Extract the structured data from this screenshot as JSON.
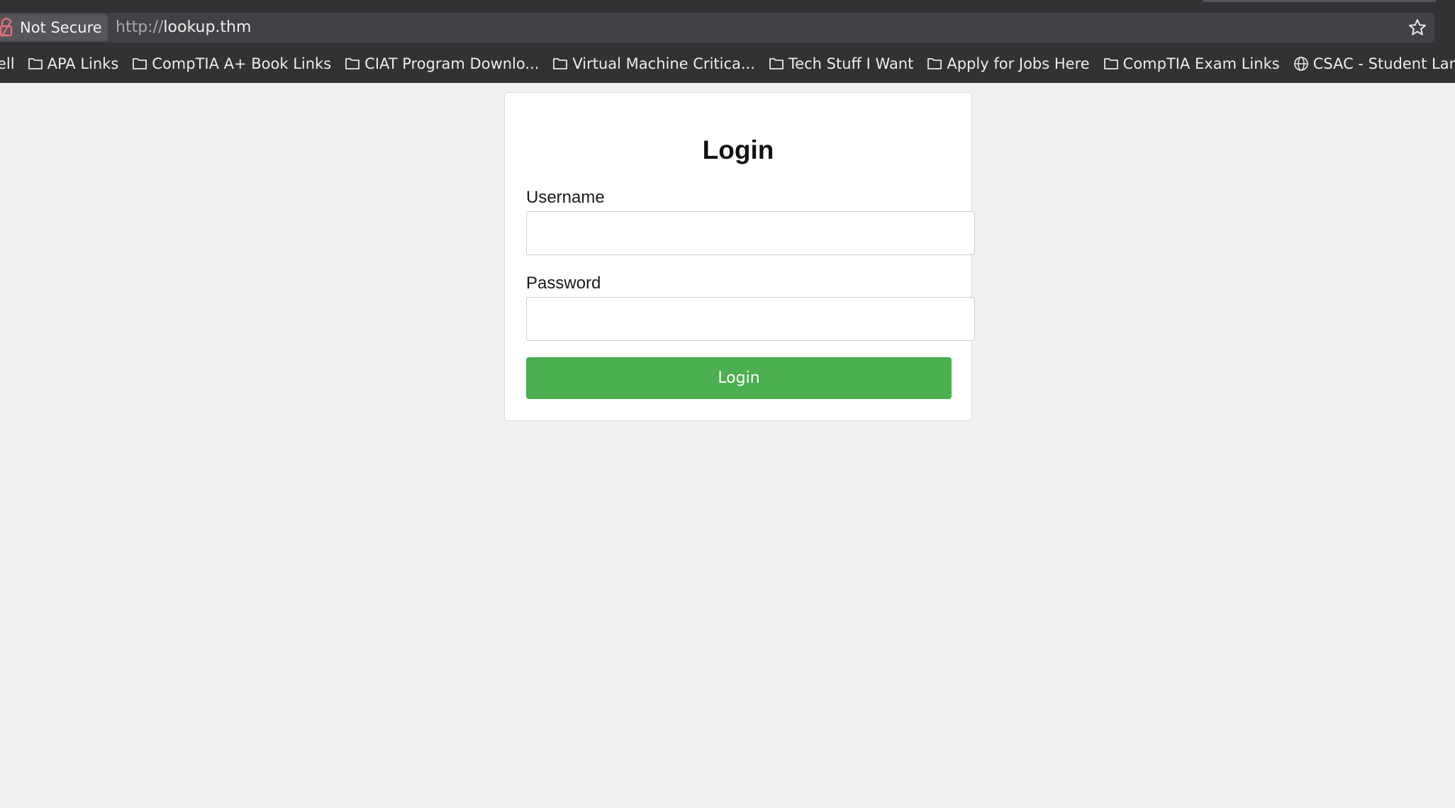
{
  "browser": {
    "security_label": "Not Secure",
    "url_scheme": "http://",
    "url_host": "lookup.thm",
    "icons": {
      "security": "broken-lock-icon",
      "bookmark_star": "star-icon",
      "folder": "folder-icon",
      "globe": "globe-icon"
    },
    "colors": {
      "security_icon": "#e5737b"
    }
  },
  "bookmarks": [
    {
      "label": "ell",
      "icon": "none"
    },
    {
      "label": "APA Links",
      "icon": "folder-icon"
    },
    {
      "label": "CompTIA A+ Book Links",
      "icon": "folder-icon"
    },
    {
      "label": "CIAT Program Downlo...",
      "icon": "folder-icon"
    },
    {
      "label": "Virtual Machine Critica...",
      "icon": "folder-icon"
    },
    {
      "label": "Tech Stuff I Want",
      "icon": "folder-icon"
    },
    {
      "label": "Apply for Jobs Here",
      "icon": "folder-icon"
    },
    {
      "label": "CompTIA Exam Links",
      "icon": "folder-icon"
    },
    {
      "label": "CSAC - Student Landin...",
      "icon": "globe-icon"
    }
  ],
  "login_form": {
    "title": "Login",
    "username_label": "Username",
    "username_value": "",
    "password_label": "Password",
    "password_value": "",
    "submit_label": "Login",
    "colors": {
      "button": "#4caf50",
      "button_text": "#ffffff"
    }
  }
}
